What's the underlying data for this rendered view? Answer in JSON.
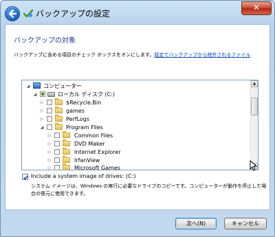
{
  "window": {
    "title": "バックアップの設定",
    "close_label": "✕"
  },
  "content": {
    "heading": "バックアップの対象",
    "instructions_prefix": "バックアップに含める項目のチェック ボックスをオンにします。",
    "instructions_link": "既定でバックアップから除外されるファイル"
  },
  "tree": {
    "items": [
      {
        "label": "コンピューター",
        "expander": "◢",
        "icon": "computer-icon"
      },
      {
        "label": "ローカル ディスク (C:)",
        "expander": "◢",
        "icon": "drive-icon",
        "checked": "partial"
      },
      {
        "label": "$Recycle.Bin",
        "expander": "▷",
        "icon": "folder-icon"
      },
      {
        "label": "games",
        "expander": "▷",
        "icon": "folder-icon"
      },
      {
        "label": "PerfLogs",
        "expander": "▷",
        "icon": "folder-icon"
      },
      {
        "label": "Program Files",
        "expander": "◢",
        "icon": "folder-icon"
      },
      {
        "label": "Common Files",
        "expander": "▷",
        "icon": "folder-icon"
      },
      {
        "label": "DVD Maker",
        "expander": "▷",
        "icon": "folder-icon"
      },
      {
        "label": "Internet Explorer",
        "expander": "▷",
        "icon": "folder-icon"
      },
      {
        "label": "IrfanView",
        "expander": "▷",
        "icon": "folder-icon"
      },
      {
        "label": "Microsoft Games",
        "expander": "▷",
        "icon": "folder-icon"
      }
    ]
  },
  "system_image": {
    "label": "Include a system image of drives: (C:)",
    "checked": true,
    "description": "システム イメージは、Windows の実行に必要なドライブのコピーです。コンピューターが動作を停止した場合の復元に使用できます。"
  },
  "buttons": {
    "next": "次へ(N)",
    "cancel": "キャンセル"
  },
  "colors": {
    "accent": "#1a3e8a",
    "link": "#0645ad",
    "close": "#c7422b"
  }
}
